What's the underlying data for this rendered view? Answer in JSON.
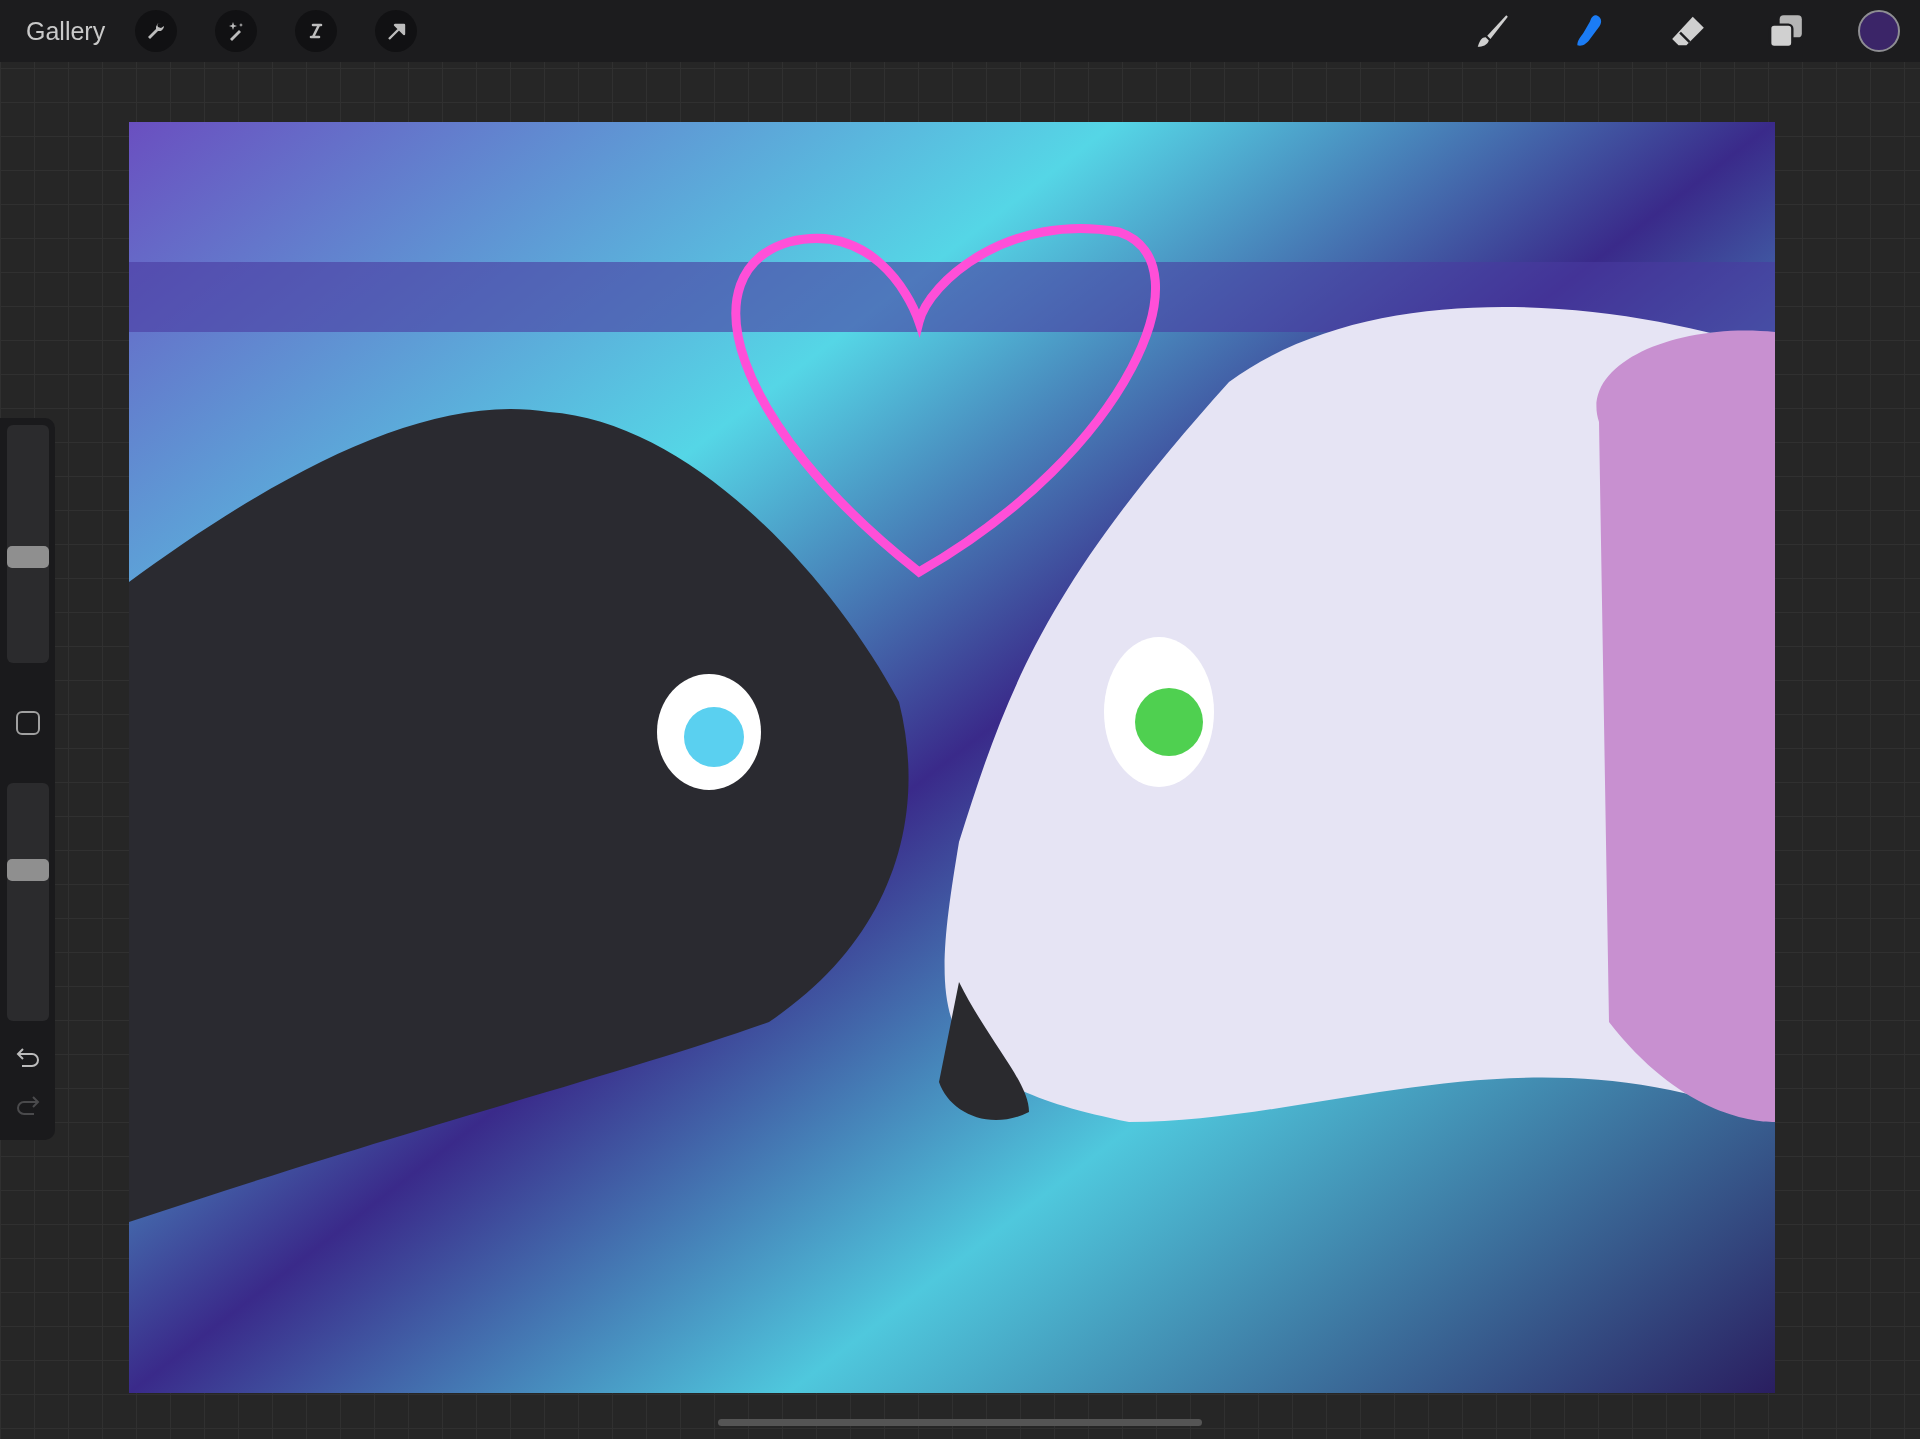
{
  "top_bar": {
    "gallery": "Gallery",
    "left_tools": [
      {
        "kind": "wrench"
      },
      {
        "kind": "wand"
      },
      {
        "kind": "selection"
      },
      {
        "kind": "arrow"
      }
    ],
    "paint_tools": [
      {
        "kind": "brush",
        "selected": false
      },
      {
        "kind": "smudge",
        "selected": true
      },
      {
        "kind": "eraser",
        "selected": false
      }
    ],
    "layers": {
      "kind": "layers"
    },
    "color_swatch": {
      "color": "#3b2568"
    }
  },
  "sidebar": {
    "sliders": [
      {
        "level": 0.44
      },
      {
        "level": 0.65
      }
    ],
    "undo": {
      "disabled": false
    },
    "redo": {
      "disabled": true
    }
  }
}
